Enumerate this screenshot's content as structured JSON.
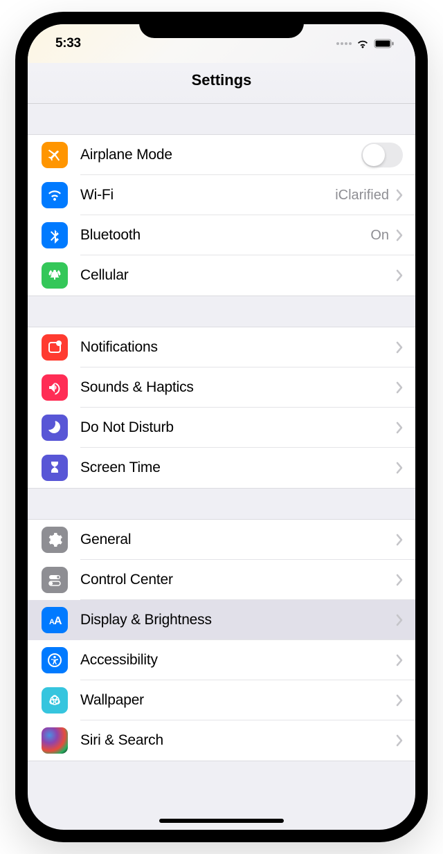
{
  "status": {
    "time": "5:33"
  },
  "header": {
    "title": "Settings"
  },
  "groups": [
    {
      "rows": [
        {
          "id": "airplane",
          "label": "Airplane Mode",
          "icon": "airplane",
          "color": "#ff9500",
          "accessory": "toggle",
          "toggle_on": false
        },
        {
          "id": "wifi",
          "label": "Wi-Fi",
          "icon": "wifi",
          "color": "#007aff",
          "accessory": "chevron",
          "detail": "iClarified"
        },
        {
          "id": "bluetooth",
          "label": "Bluetooth",
          "icon": "bluetooth",
          "color": "#007aff",
          "accessory": "chevron",
          "detail": "On"
        },
        {
          "id": "cellular",
          "label": "Cellular",
          "icon": "cellular",
          "color": "#34c759",
          "accessory": "chevron"
        }
      ]
    },
    {
      "rows": [
        {
          "id": "notifications",
          "label": "Notifications",
          "icon": "notifications",
          "color": "#ff3b30",
          "accessory": "chevron"
        },
        {
          "id": "sounds",
          "label": "Sounds & Haptics",
          "icon": "sounds",
          "color": "#ff2d55",
          "accessory": "chevron"
        },
        {
          "id": "dnd",
          "label": "Do Not Disturb",
          "icon": "moon",
          "color": "#5856d6",
          "accessory": "chevron"
        },
        {
          "id": "screentime",
          "label": "Screen Time",
          "icon": "hourglass",
          "color": "#5856d6",
          "accessory": "chevron"
        }
      ]
    },
    {
      "rows": [
        {
          "id": "general",
          "label": "General",
          "icon": "gear",
          "color": "#8e8e93",
          "accessory": "chevron"
        },
        {
          "id": "control-center",
          "label": "Control Center",
          "icon": "toggles",
          "color": "#8e8e93",
          "accessory": "chevron"
        },
        {
          "id": "display",
          "label": "Display & Brightness",
          "icon": "textsize",
          "color": "#007aff",
          "accessory": "chevron",
          "highlighted": true
        },
        {
          "id": "accessibility",
          "label": "Accessibility",
          "icon": "accessibility",
          "color": "#007aff",
          "accessory": "chevron"
        },
        {
          "id": "wallpaper",
          "label": "Wallpaper",
          "icon": "wallpaper",
          "color": "#36c5de",
          "accessory": "chevron"
        },
        {
          "id": "siri",
          "label": "Siri & Search",
          "icon": "siri",
          "color": "siri",
          "accessory": "chevron"
        }
      ]
    }
  ]
}
